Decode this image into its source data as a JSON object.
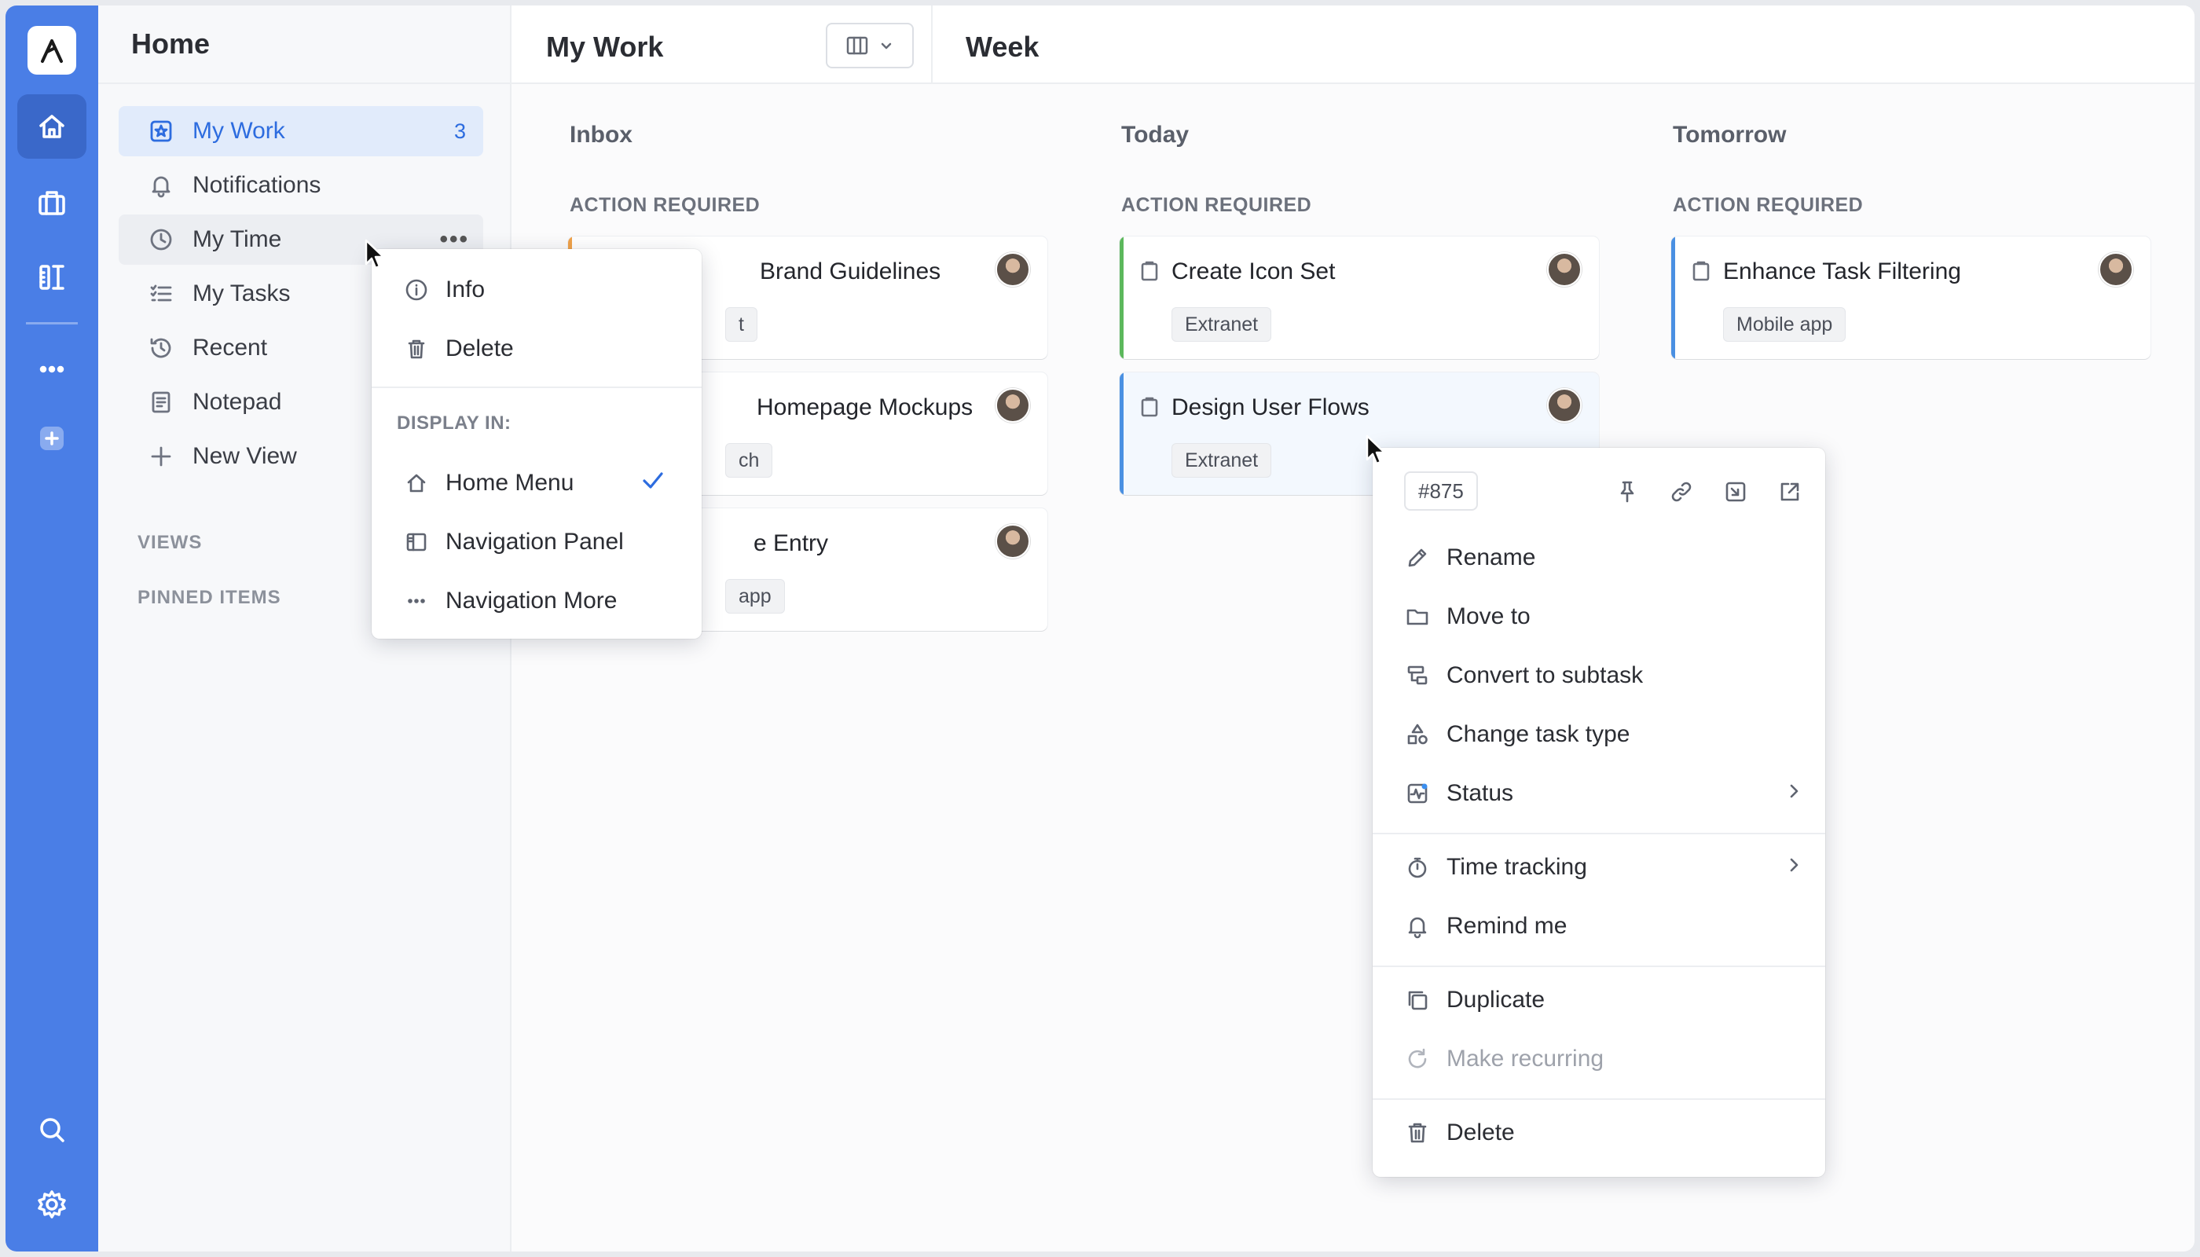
{
  "rail": {
    "icons": [
      "logo-icon",
      "home-icon",
      "briefcase-icon",
      "tools-icon",
      "more-icon",
      "add-icon",
      "search-icon",
      "gear-icon"
    ],
    "accent": "#4a7ee6"
  },
  "sidebar": {
    "title": "Home",
    "items": [
      {
        "label": "My Work",
        "count": "3"
      },
      {
        "label": "Notifications"
      },
      {
        "label": "My Time"
      },
      {
        "label": "My Tasks"
      },
      {
        "label": "Recent"
      },
      {
        "label": "Notepad"
      },
      {
        "label": "New View"
      }
    ],
    "views_label": "VIEWS",
    "pinned_label": "PINNED ITEMS"
  },
  "main": {
    "title": "My Work",
    "week_title": "Week",
    "columns": [
      {
        "title": "Inbox",
        "section": "ACTION REQUIRED"
      },
      {
        "title": "Today",
        "section": "ACTION REQUIRED"
      },
      {
        "title": "Tomorrow",
        "section": "ACTION REQUIRED"
      }
    ],
    "inbox_cards": [
      {
        "title": "Brand Guidelines",
        "tag": "t"
      },
      {
        "title": "Homepage Mockups",
        "tag": "ch"
      },
      {
        "title": "e Entry",
        "tag": "app"
      }
    ],
    "today_cards": [
      {
        "title": "Create Icon Set",
        "tag": "Extranet",
        "color": "#5cb85c"
      },
      {
        "title": "Design User Flows",
        "tag": "Extranet",
        "color": "#4a90e2"
      }
    ],
    "tomorrow_cards": [
      {
        "title": "Enhance Task Filtering",
        "tag": "Mobile app",
        "color": "#4a90e2"
      }
    ]
  },
  "nav_menu": {
    "info": "Info",
    "delete": "Delete",
    "display_label": "DISPLAY IN:",
    "home_menu": "Home Menu",
    "nav_panel": "Navigation Panel",
    "nav_more": "Navigation More"
  },
  "task_menu": {
    "id": "#875",
    "rename": "Rename",
    "move_to": "Move to",
    "convert": "Convert to subtask",
    "change_type": "Change task type",
    "status": "Status",
    "time_tracking": "Time tracking",
    "remind": "Remind me",
    "duplicate": "Duplicate",
    "recurring": "Make recurring",
    "delete": "Delete"
  }
}
